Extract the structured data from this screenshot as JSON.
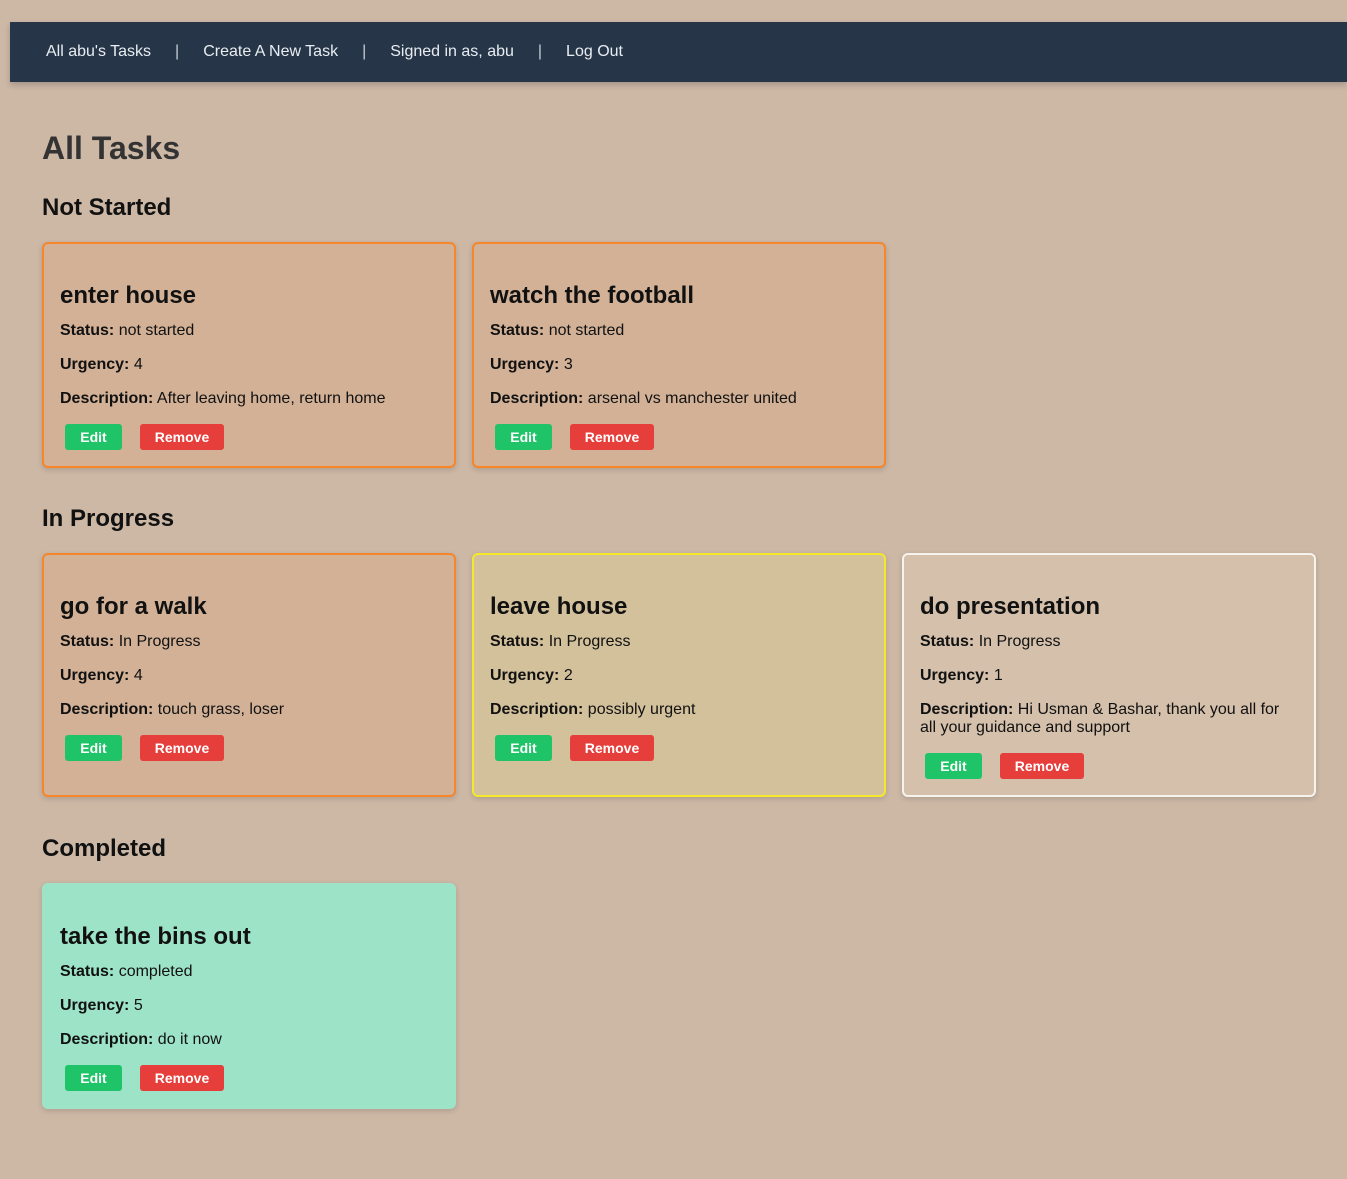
{
  "nav": {
    "items": [
      "All abu's Tasks",
      "Create A New Task",
      "Signed in as, abu",
      "Log Out"
    ],
    "separator": "|"
  },
  "page_title": "All Tasks",
  "labels": {
    "status": "Status:",
    "urgency": "Urgency:",
    "description": "Description:",
    "edit": "Edit",
    "remove": "Remove"
  },
  "sections": [
    {
      "title": "Not Started",
      "tasks": [
        {
          "title": "enter house",
          "status": "not started",
          "urgency": "4",
          "description": "After leaving home, return home",
          "border_color": "#f5862a"
        },
        {
          "title": "watch the football",
          "status": "not started",
          "urgency": "3",
          "description": "arsenal vs manchester united",
          "border_color": "#f5862a"
        }
      ]
    },
    {
      "title": "In Progress",
      "tasks": [
        {
          "title": "go for a walk",
          "status": "In Progress",
          "urgency": "4",
          "description": "touch grass, loser",
          "border_color": "#f5862a"
        },
        {
          "title": "leave house",
          "status": "In Progress",
          "urgency": "2",
          "description": "possibly urgent",
          "border_color": "#f5e82a"
        },
        {
          "title": "do presentation",
          "status": "In Progress",
          "urgency": "1",
          "description": "Hi Usman & Bashar, thank you all for all your guidance and support",
          "border_color": "#f7f3ee"
        }
      ]
    },
    {
      "title": "Completed",
      "tasks": [
        {
          "title": "take the bins out",
          "status": "completed",
          "urgency": "5",
          "description": "do it now",
          "background": "#9de3c8"
        }
      ]
    }
  ],
  "colors": {
    "nav_bg": "#263648",
    "page_bg": "#cdb8a6",
    "edit": "#1fc468",
    "remove": "#e53e3b"
  }
}
